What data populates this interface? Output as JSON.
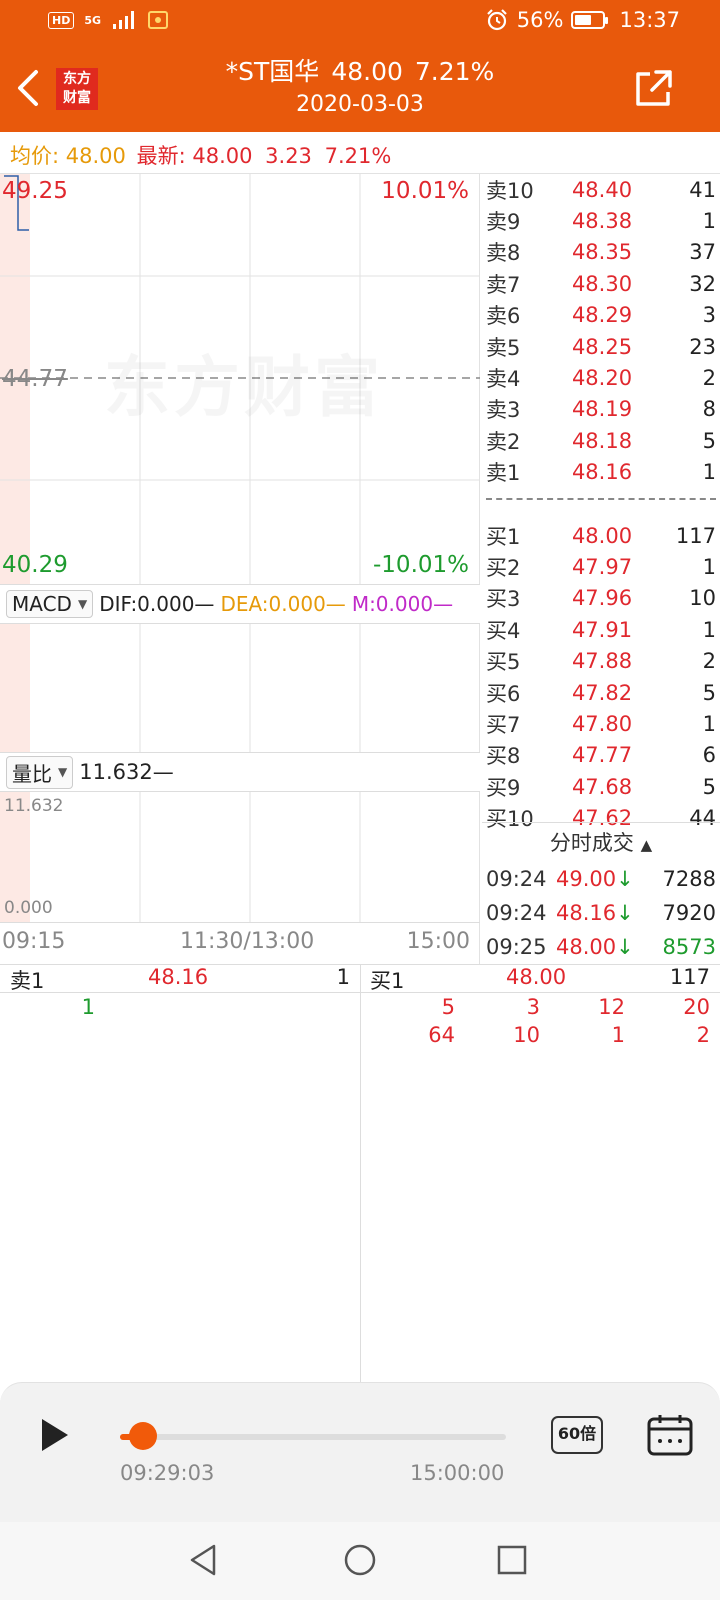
{
  "status_bar": {
    "hd": "HD",
    "network": "5G",
    "battery_percent": "56%",
    "time": "13:37"
  },
  "header": {
    "logo_line1": "东方",
    "logo_line2": "财富",
    "stock_name": "*ST国华",
    "price": "48.00",
    "change_pct": "7.21%",
    "date": "2020-03-03",
    "accent_color": "#e8590c"
  },
  "info": {
    "avg_label": "均价:",
    "avg_value": "48.00",
    "latest_label": "最新:",
    "latest_value": "48.00",
    "change": "3.23",
    "change_pct": "7.21%"
  },
  "chart": {
    "y_high": "49.25",
    "y_high_pct": "10.01%",
    "y_mid": "44.77",
    "y_low": "40.29",
    "y_low_pct": "-10.01%",
    "watermark": "东方财富",
    "macd": {
      "selector": "MACD",
      "dif": "DIF:0.000—",
      "dea": "DEA:0.000—",
      "m": "M:0.000—"
    },
    "volume_ratio": {
      "selector": "量比",
      "value": "11.632—",
      "axis_top": "11.632",
      "axis_bottom": "0.000"
    },
    "x_labels": [
      "09:15",
      "11:30/13:00",
      "15:00"
    ]
  },
  "orderbook": {
    "asks": [
      {
        "label": "卖10",
        "price": "48.40",
        "vol": "41"
      },
      {
        "label": "卖9",
        "price": "48.38",
        "vol": "1"
      },
      {
        "label": "卖8",
        "price": "48.35",
        "vol": "37"
      },
      {
        "label": "卖7",
        "price": "48.30",
        "vol": "32"
      },
      {
        "label": "卖6",
        "price": "48.29",
        "vol": "3"
      },
      {
        "label": "卖5",
        "price": "48.25",
        "vol": "23"
      },
      {
        "label": "卖4",
        "price": "48.20",
        "vol": "2"
      },
      {
        "label": "卖3",
        "price": "48.19",
        "vol": "8"
      },
      {
        "label": "卖2",
        "price": "48.18",
        "vol": "5"
      },
      {
        "label": "卖1",
        "price": "48.16",
        "vol": "1"
      }
    ],
    "bids": [
      {
        "label": "买1",
        "price": "48.00",
        "vol": "117"
      },
      {
        "label": "买2",
        "price": "47.97",
        "vol": "1"
      },
      {
        "label": "买3",
        "price": "47.96",
        "vol": "10"
      },
      {
        "label": "买4",
        "price": "47.91",
        "vol": "1"
      },
      {
        "label": "买5",
        "price": "47.88",
        "vol": "2"
      },
      {
        "label": "买6",
        "price": "47.82",
        "vol": "5"
      },
      {
        "label": "买7",
        "price": "47.80",
        "vol": "1"
      },
      {
        "label": "买8",
        "price": "47.77",
        "vol": "6"
      },
      {
        "label": "买9",
        "price": "47.68",
        "vol": "5"
      },
      {
        "label": "买10",
        "price": "47.62",
        "vol": "44"
      }
    ]
  },
  "ticks": {
    "title": "分时成交",
    "rows": [
      {
        "time": "09:24",
        "price": "49.00",
        "arrow": "↓",
        "vol": "7288",
        "vol_color": "dark"
      },
      {
        "time": "09:24",
        "price": "48.16",
        "arrow": "↓",
        "vol": "7920",
        "vol_color": "dark"
      },
      {
        "time": "09:25",
        "price": "48.00",
        "arrow": "↓",
        "vol": "8573",
        "vol_color": "green"
      }
    ]
  },
  "queue": {
    "sell": {
      "label": "卖1",
      "price": "48.16",
      "vol": "1",
      "orders": [
        "1"
      ]
    },
    "buy": {
      "label": "买1",
      "price": "48.00",
      "vol": "117",
      "orders": [
        "5",
        "3",
        "12",
        "20",
        "64",
        "10",
        "1",
        "2"
      ]
    }
  },
  "playback": {
    "current_time": "09:29:03",
    "end_time": "15:00:00",
    "speed": "60倍",
    "progress_fraction": 0.06
  }
}
